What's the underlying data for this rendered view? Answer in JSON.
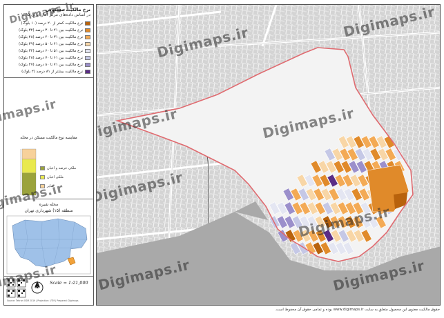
{
  "legend": {
    "title": "نرخ مالکیت مسکونی",
    "subtitle": "در اساس داده‌های مرکز آمار ایران ۱۳۹۵",
    "items": [
      {
        "label": "نرخ مالکیت کمتر از ۲۰ درصد (۱۰ بلوک)",
        "color": "#b8620c"
      },
      {
        "label": "نرخ مالکیت بین ۲۱ تا ۳۰ درصد (۳۲ بلوک)",
        "color": "#e08a2a"
      },
      {
        "label": "نرخ مالکیت بین ۳۱ تا ۴۰ درصد (۴۸ بلوک)",
        "color": "#f3aa55"
      },
      {
        "label": "نرخ مالکیت بین ۴۱ تا ۵۰ درصد (۳۹ بلوک)",
        "color": "#f8d6a6"
      },
      {
        "label": "نرخ مالکیت بین ۵۱ تا ۶۰ درصد (۳۴ بلوک)",
        "color": "#e4e6f2"
      },
      {
        "label": "نرخ مالکیت بین ۶۱ تا ۷۰ درصد (۴۸ بلوک)",
        "color": "#c5c8e6"
      },
      {
        "label": "نرخ مالکیت بین ۷۱ تا ۸۰ درصد (۲۷ بلوک)",
        "color": "#9b8fcb"
      },
      {
        "label": "نرخ مالکیت بیشتر از ۸۱ درصد (۲ بلوک)",
        "color": "#5a2d86"
      }
    ]
  },
  "chart": {
    "title": "مقایسه نوع مالکیت مسکن در محله",
    "keys": [
      {
        "label": "ملکی عرصه و اعیان",
        "color": "#9ba33c"
      },
      {
        "label": "ملکی اعیان",
        "color": "#e9e94e"
      },
      {
        "label": "سایر",
        "color": "#f7d19a"
      }
    ]
  },
  "chart_data": {
    "type": "bar",
    "stacked": true,
    "categories": [
      ""
    ],
    "series": [
      {
        "name": "ملکی عرصه و اعیان",
        "values": [
          48
        ]
      },
      {
        "name": "ملکی اعیان",
        "values": [
          30
        ]
      },
      {
        "name": "سایر",
        "values": [
          22
        ]
      }
    ],
    "ylim": [
      0,
      100
    ],
    "grid": false,
    "legend_position": "right"
  },
  "locator": {
    "title": "محله شیره",
    "subtitle": "منطقه (۱۵) شهرداری تهران"
  },
  "scale": {
    "label": "Scale = 1:21,000"
  },
  "north_arrow": {
    "label": "N"
  },
  "credit": "Source: Tehran OSM 2019 | Projection: UTM | Prepared: Digimaps",
  "watermark": "Digimaps.ir",
  "footer": "حقوق مالکیت معنوی این محصول متعلق به سایت www.digimaps.ir بوده و تمامی حقوق آن محفوظ است.",
  "colors": {
    "boundary": "#e06b70",
    "lake": "#a9a9a9",
    "park": "#f3f3f3",
    "locator_region": "#9fc1e8",
    "locator_highlight": "#f2a23a"
  }
}
